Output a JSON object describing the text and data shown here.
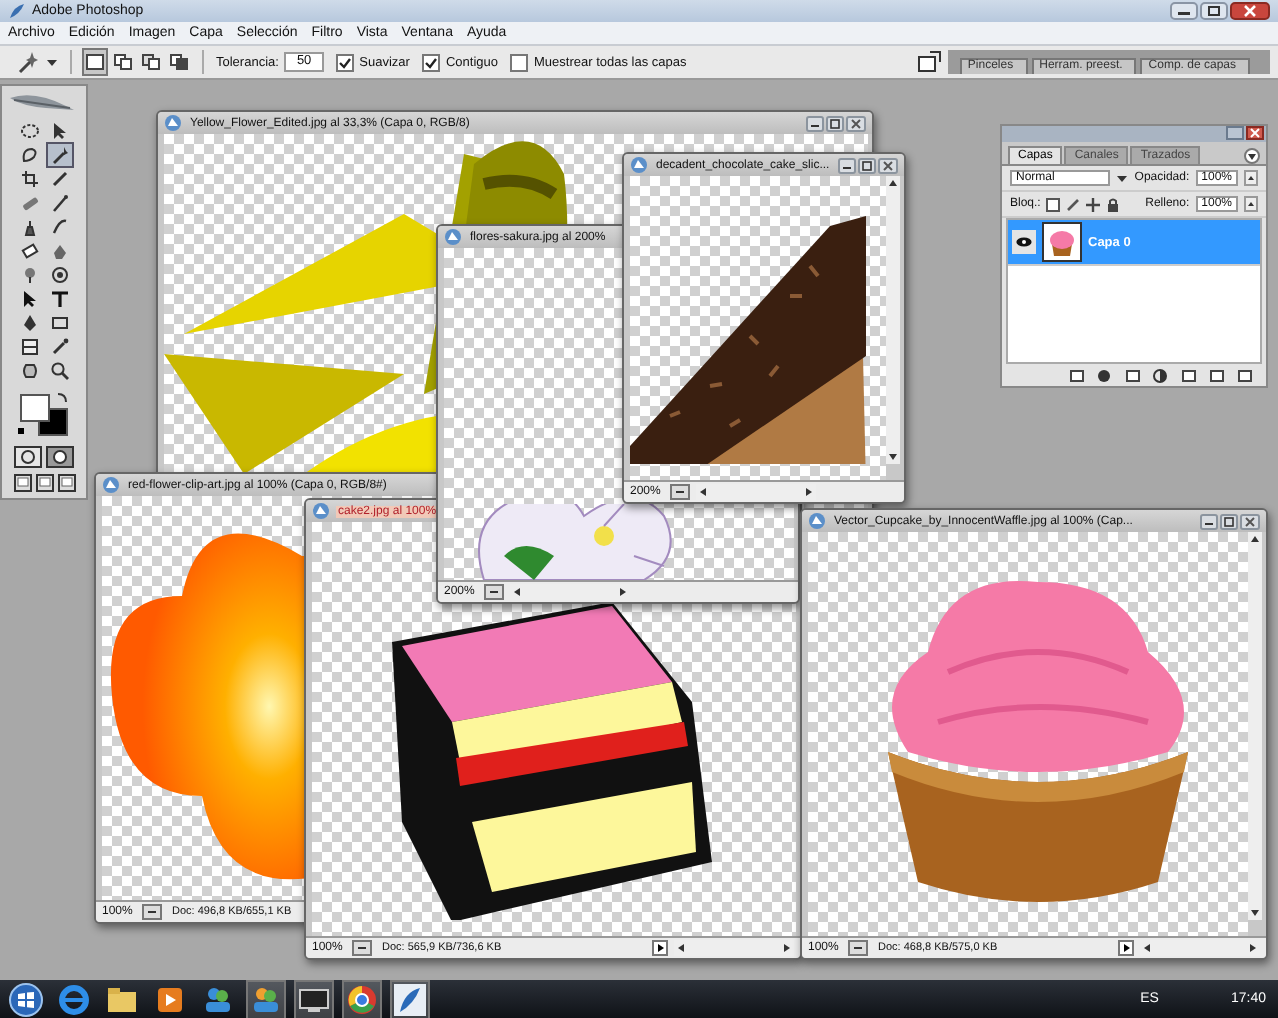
{
  "app": {
    "title": "Adobe Photoshop"
  },
  "menu": [
    "Archivo",
    "Edición",
    "Imagen",
    "Capa",
    "Selección",
    "Filtro",
    "Vista",
    "Ventana",
    "Ayuda"
  ],
  "options": {
    "tolerance_label": "Tolerancia:",
    "tolerance": "50",
    "checkboxes": [
      {
        "label": "Suavizar",
        "checked": true
      },
      {
        "label": "Contiguo",
        "checked": true
      },
      {
        "label": "Muestrear todas las capas",
        "checked": false
      }
    ]
  },
  "panel_well": [
    "Pinceles",
    "Herram. preest.",
    "Comp. de capas"
  ],
  "documents": [
    {
      "title": "Yellow_Flower_Edited.jpg al 33,3% (Capa 0, RGB/8)",
      "kind": "yellow-flower",
      "active": false
    },
    {
      "title": "red-flower-clip-art.jpg al 100% (Capa 0, RGB/8#)",
      "kind": "red-flower",
      "active": false,
      "zoom": "100%",
      "doc_size": "Doc: 496,8 KB/655,1 KB"
    },
    {
      "title": "cake2.jpg al 100%",
      "kind": "cake",
      "active": true,
      "zoom": "100%",
      "doc_size": "Doc: 565,9 KB/736,6 KB"
    },
    {
      "title": "flores-sakura.jpg al 200%",
      "kind": "sakura",
      "active": false,
      "zoom": "200%"
    },
    {
      "title": "decadent_chocolate_cake_slic...",
      "kind": "chocolate",
      "active": false,
      "zoom": "200%"
    },
    {
      "title": "Vector_Cupcake_by_InnocentWaffle.jpg al 100% (Cap...",
      "kind": "cupcake",
      "active": false,
      "zoom": "100%",
      "doc_size": "Doc: 468,8 KB/575,0 KB"
    }
  ],
  "layers_panel": {
    "tabs": [
      {
        "label": "Capas",
        "selected": true
      },
      {
        "label": "Canales",
        "selected": false
      },
      {
        "label": "Trazados",
        "selected": false
      }
    ],
    "blend_mode": "Normal",
    "opacity_label": "Opacidad:",
    "opacity": "100%",
    "lock_label": "Bloq.:",
    "fill_label": "Relleno:",
    "fill": "100%",
    "layers": [
      {
        "name": "Capa 0",
        "selected": true,
        "visible": true
      }
    ]
  },
  "taskbar": {
    "language": "ES",
    "time": "17:40"
  }
}
